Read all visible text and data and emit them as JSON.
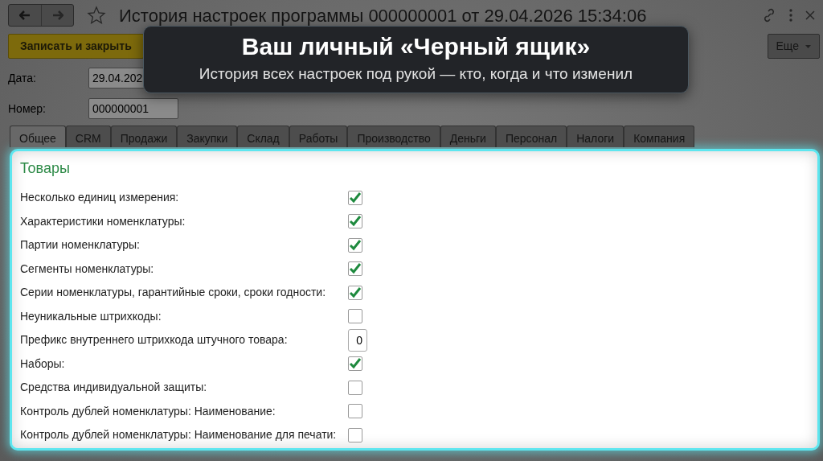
{
  "window": {
    "title": "История настроек программы 000000001 от 29.04.2026 15:34:06"
  },
  "toolbar": {
    "save_button": "Записать и закрыть",
    "more_button": "Еще"
  },
  "fields": [
    {
      "label": "Дата:",
      "value": "29.04.202"
    },
    {
      "label": "Номер:",
      "value": "000000001"
    }
  ],
  "tabs": [
    {
      "label": "Общее",
      "selected": true
    },
    {
      "label": "CRM",
      "selected": false
    },
    {
      "label": "Продажи",
      "selected": false
    },
    {
      "label": "Закупки",
      "selected": false
    },
    {
      "label": "Склад",
      "selected": false
    },
    {
      "label": "Работы",
      "selected": false
    },
    {
      "label": "Производство",
      "selected": false
    },
    {
      "label": "Деньги",
      "selected": false
    },
    {
      "label": "Персонал",
      "selected": false
    },
    {
      "label": "Налоги",
      "selected": false
    },
    {
      "label": "Компания",
      "selected": false
    }
  ],
  "section": {
    "title": "Товары",
    "settings": [
      {
        "kind": "checkbox",
        "label": "Несколько единиц измерения:",
        "checked": true
      },
      {
        "kind": "checkbox",
        "label": "Характеристики номенклатуры:",
        "checked": true
      },
      {
        "kind": "checkbox",
        "label": "Партии номенклатуры:",
        "checked": true
      },
      {
        "kind": "checkbox",
        "label": "Сегменты номенклатуры:",
        "checked": true
      },
      {
        "kind": "checkbox",
        "label": "Серии номенклатуры, гарантийные сроки, сроки годности:",
        "checked": true
      },
      {
        "kind": "checkbox",
        "label": "Неуникальные штрихкоды:",
        "checked": false
      },
      {
        "kind": "number",
        "label": "Префикс внутреннего штрихкода штучного товара:",
        "value": "0"
      },
      {
        "kind": "checkbox",
        "label": "Наборы:",
        "checked": true
      },
      {
        "kind": "checkbox",
        "label": "Средства индивидуальной защиты:",
        "checked": false
      },
      {
        "kind": "checkbox",
        "label": "Контроль дублей номенклатуры: Наименование:",
        "checked": false
      },
      {
        "kind": "checkbox",
        "label": "Контроль дублей номенклатуры: Наименование для печати:",
        "checked": false
      }
    ]
  },
  "callout": {
    "title": "Ваш личный «Черный ящик»",
    "subtitle": "История всех настроек под рукой — кто, когда и что изменил"
  }
}
